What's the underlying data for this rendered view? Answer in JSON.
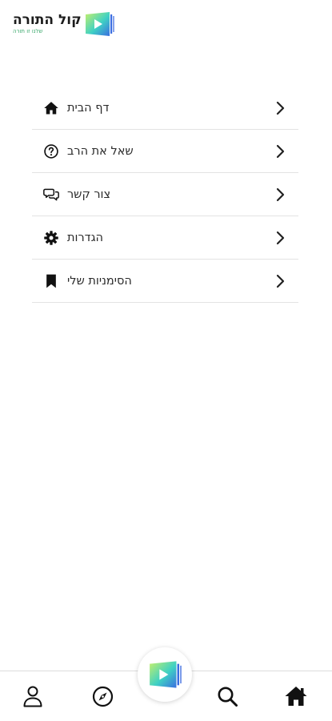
{
  "header": {
    "app_title": "קול התורה",
    "tagline": "שלנו זו תורה",
    "logo_icon": "video-play-logo"
  },
  "menu": {
    "items": [
      {
        "label": "דף הבית",
        "icon": "home-icon"
      },
      {
        "label": "שאל את הרב",
        "icon": "question-circle-icon"
      },
      {
        "label": "צור קשר",
        "icon": "chat-bubbles-icon"
      },
      {
        "label": "הגדרות",
        "icon": "gear-icon"
      },
      {
        "label": "הסימניות שלי",
        "icon": "bookmark-icon"
      }
    ],
    "chevron_icon": "chevron-right-icon"
  },
  "bottom_nav": {
    "items": [
      {
        "icon": "user-icon"
      },
      {
        "icon": "compass-icon"
      },
      {
        "icon": "video-play-logo"
      },
      {
        "icon": "search-icon"
      },
      {
        "icon": "home-icon"
      }
    ]
  },
  "colors": {
    "divider": "#e3e3e3",
    "text": "#2a2a2a",
    "logo_gradient_start": "#c6f06a",
    "logo_gradient_mid": "#3fd1c4",
    "logo_gradient_end": "#3a6ee0"
  }
}
